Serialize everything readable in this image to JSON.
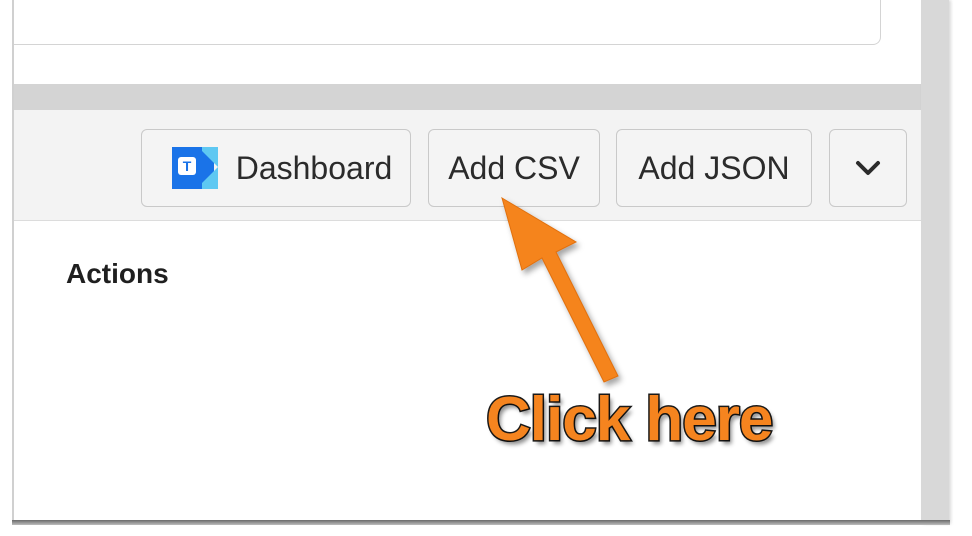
{
  "toolbar": {
    "dashboard_label": "Dashboard",
    "dashboard_logo_letter": "T",
    "add_csv_label": "Add CSV",
    "add_json_label": "Add JSON",
    "more_icon": "chevron-down-icon"
  },
  "main": {
    "actions_heading": "Actions"
  },
  "annotation": {
    "callout_text": "Click here",
    "arrow_color": "#f5841f"
  },
  "colors": {
    "accent_orange": "#f5841f",
    "logo_blue": "#1a73e8",
    "logo_light_blue": "#5ec8f2"
  }
}
